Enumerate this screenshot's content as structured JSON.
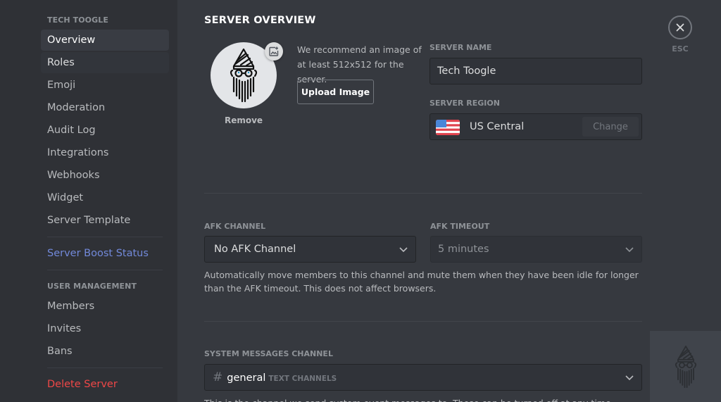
{
  "sidebar": {
    "server_header": "TECH TOOGLE",
    "items": [
      {
        "label": "Overview",
        "state": "selected"
      },
      {
        "label": "Roles",
        "state": "hover"
      },
      {
        "label": "Emoji"
      },
      {
        "label": "Moderation"
      },
      {
        "label": "Audit Log"
      },
      {
        "label": "Integrations"
      },
      {
        "label": "Webhooks"
      },
      {
        "label": "Widget"
      },
      {
        "label": "Server Template"
      }
    ],
    "boost_label": "Server Boost Status",
    "user_mgmt_header": "USER MANAGEMENT",
    "user_mgmt_items": [
      {
        "label": "Members"
      },
      {
        "label": "Invites"
      },
      {
        "label": "Bans"
      }
    ],
    "delete_label": "Delete Server"
  },
  "main": {
    "title": "SERVER OVERVIEW",
    "icon": {
      "name": "wizard-avatar",
      "upload_badge_icon": "add-image-icon",
      "remove_label": "Remove",
      "recommend_text": "We recommend an image of at least 512x512 for the server.",
      "upload_button": "Upload Image"
    },
    "server_name": {
      "label": "SERVER NAME",
      "value": "Tech Toogle"
    },
    "server_region": {
      "label": "SERVER REGION",
      "flag": "us-flag",
      "value": "US Central",
      "change_button": "Change"
    },
    "afk_channel": {
      "label": "AFK CHANNEL",
      "value": "No AFK Channel"
    },
    "afk_timeout": {
      "label": "AFK TIMEOUT",
      "value": "5 minutes"
    },
    "afk_help": "Automatically move members to this channel and mute them when they have been idle for longer than the AFK timeout. This does not affect browsers.",
    "system_channel": {
      "label": "SYSTEM MESSAGES CHANNEL",
      "channel_prefix": "#",
      "channel_name": "general",
      "channel_category": "TEXT CHANNELS",
      "help": "This is the channel we send system event messages to. These can be turned off at any time."
    }
  },
  "close": {
    "icon": "close-icon",
    "label": "ESC"
  },
  "colors": {
    "sidebar_bg": "#2f3136",
    "main_bg": "#36393f",
    "accent": "#7289da",
    "danger": "#f04747"
  }
}
